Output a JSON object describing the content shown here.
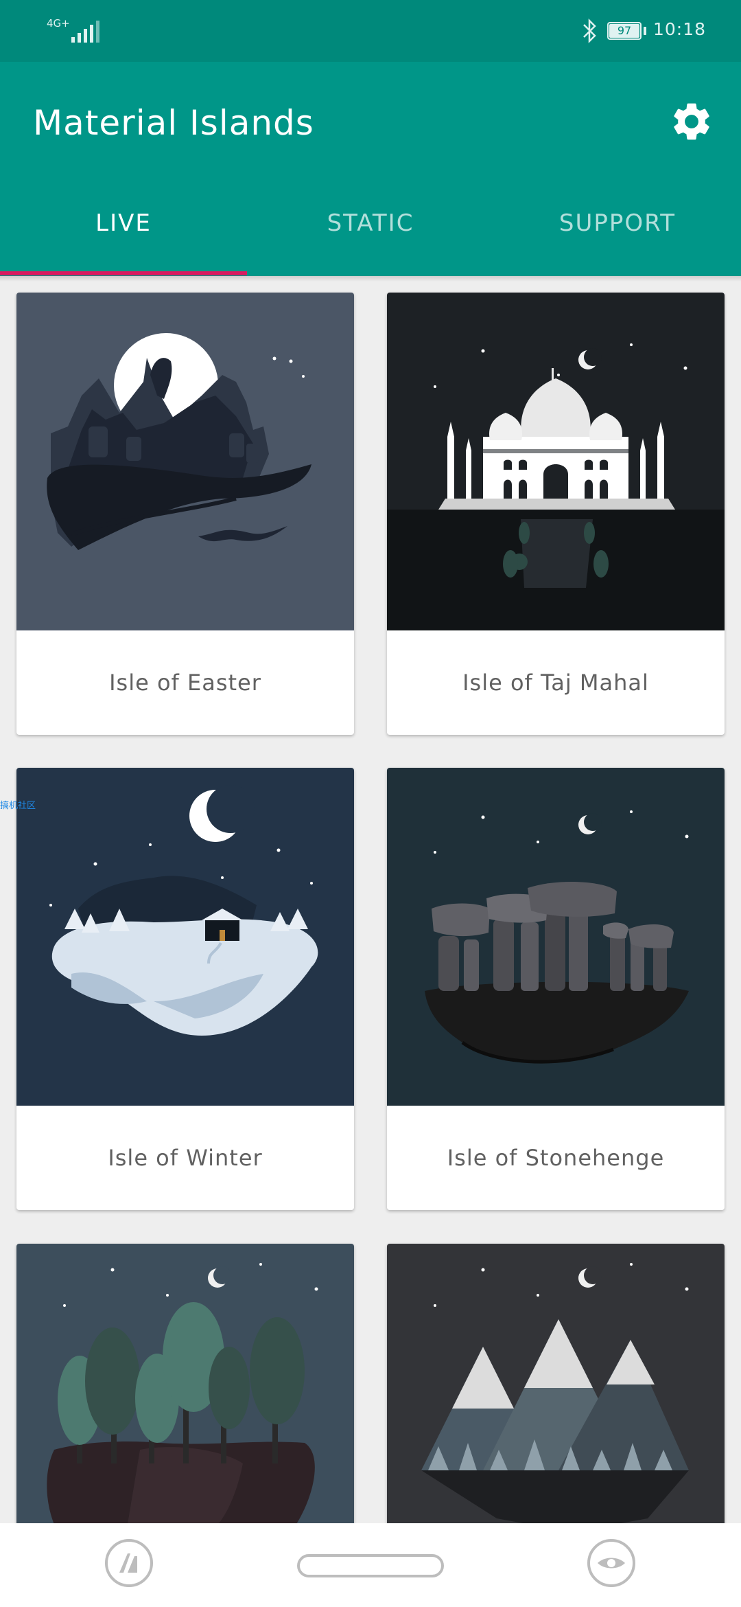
{
  "status_bar": {
    "network": "4G+",
    "battery": "97",
    "time": "10:18"
  },
  "app": {
    "title": "Material Islands",
    "settings_icon": "gear-icon"
  },
  "tabs": [
    {
      "label": "LIVE",
      "active": true
    },
    {
      "label": "STATIC",
      "active": false
    },
    {
      "label": "SUPPORT",
      "active": false
    }
  ],
  "colors": {
    "primary": "#009688",
    "primary_dark": "#00897b",
    "accent": "#d81b60"
  },
  "islands": [
    {
      "name": "Isle of Easter"
    },
    {
      "name": "Isle of Taj Mahal"
    },
    {
      "name": "Isle of Winter"
    },
    {
      "name": "Isle of Stonehenge"
    },
    {
      "name": ""
    },
    {
      "name": ""
    }
  ],
  "watermark": "搞机社区",
  "nav": {
    "left_icon": "app-switch-icon",
    "right_icon": "eye-icon"
  }
}
